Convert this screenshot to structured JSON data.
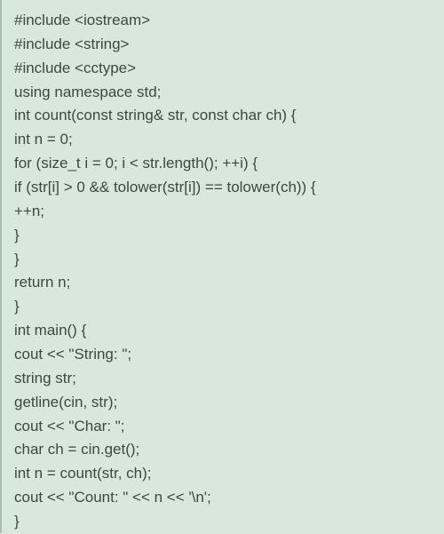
{
  "code": {
    "lines": [
      "#include <iostream>",
      "#include <string>",
      "#include <cctype>",
      "using namespace std;",
      "int count(const string& str, const char ch) {",
      "int n = 0;",
      "for (size_t i = 0; i < str.length(); ++i) {",
      "if (str[i] > 0 && tolower(str[i]) == tolower(ch)) {",
      "++n;",
      "}",
      "}",
      "return n;",
      "}",
      "int main() {",
      "cout << \"String: \";",
      "string str;",
      "getline(cin, str);",
      "cout << \"Char: \";",
      "char ch = cin.get();",
      "int n = count(str, ch);",
      "cout << \"Count: \" << n << '\\n';",
      "}"
    ]
  }
}
